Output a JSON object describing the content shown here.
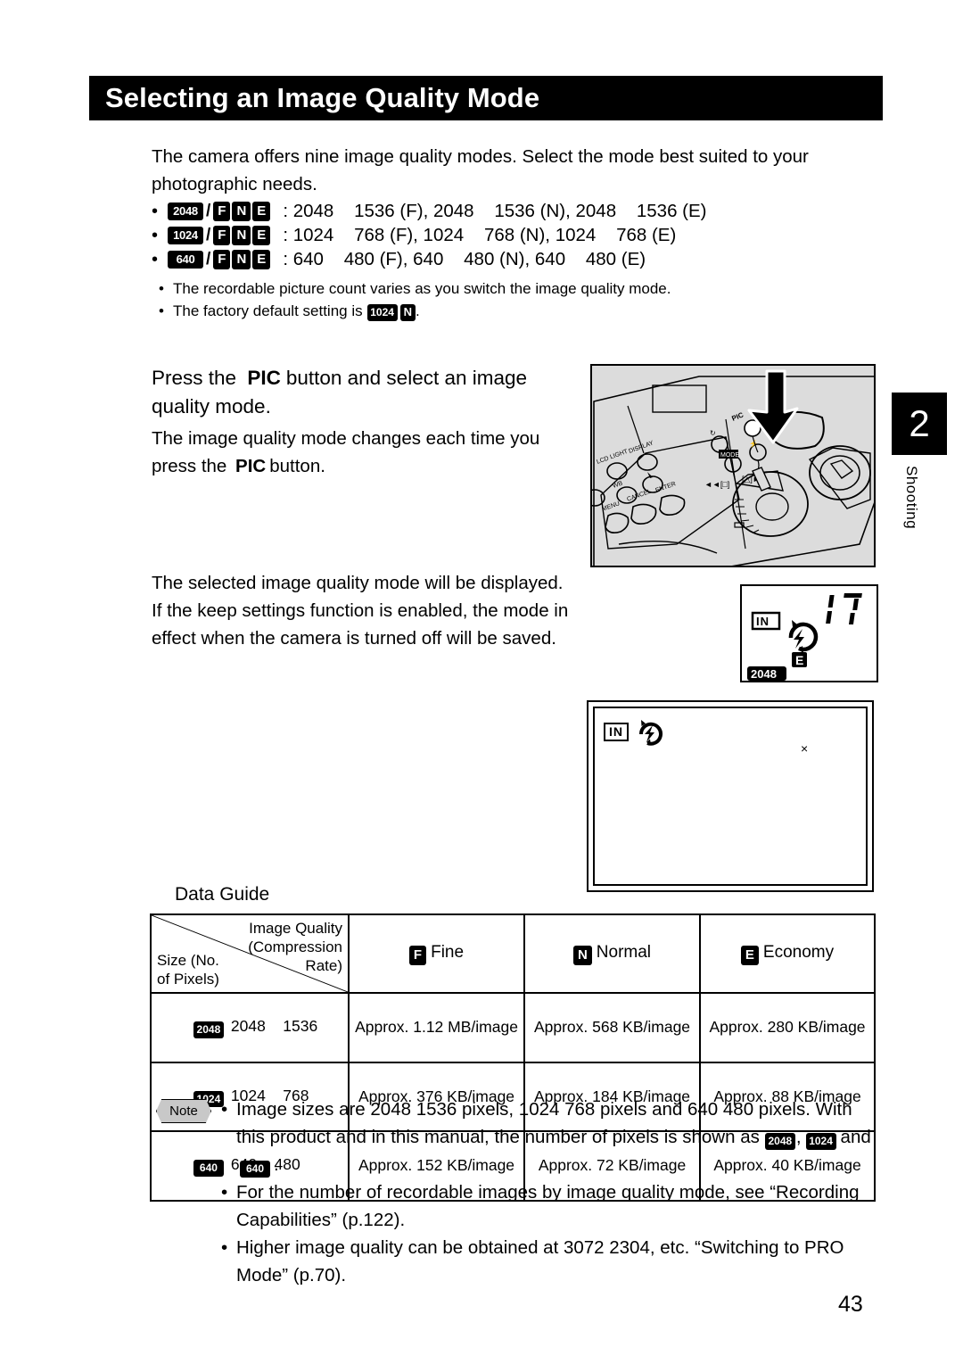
{
  "page": {
    "title": "Selecting an Image Quality Mode",
    "number": "43"
  },
  "chapter_tab": {
    "number": "2",
    "label": "Shooting"
  },
  "intro": {
    "paragraph": "The camera offers nine image quality modes. Select the mode best suited to your photographic needs.",
    "mode_lines": [
      {
        "size_badge": "2048",
        "quality_badges": [
          "F",
          "N",
          "E"
        ],
        "description": ": 2048    1536 (F), 2048    1536 (N), 2048    1536 (E)"
      },
      {
        "size_badge": "1024",
        "quality_badges": [
          "F",
          "N",
          "E"
        ],
        "description": ": 1024    768 (F), 1024    768 (N), 1024    768 (E)"
      },
      {
        "size_badge": "640",
        "quality_badges": [
          "F",
          "N",
          "E"
        ],
        "description": ": 640    480 (F), 640    480 (N), 640    480 (E)"
      }
    ],
    "sub_bullets": {
      "first": "The recordable picture count varies as you switch the image quality mode.",
      "second_prefix": "The factory default setting is",
      "second_badge_size": "1024",
      "second_badge_quality": "N",
      "second_suffix": "."
    }
  },
  "step1": {
    "heading_part1": "Press the",
    "heading_button": "PIC",
    "heading_part2": "button and select an image quality mode.",
    "sub_part1": "The image quality mode changes each time you press the",
    "sub_button": "PIC",
    "sub_part2": "button."
  },
  "step2": {
    "line1": "The selected image quality mode will be displayed.",
    "line2": "If the keep settings function is enabled, the mode in effect when the camera is turned off will be saved."
  },
  "figures": {
    "camera": {
      "callout_button": "PIC",
      "button_labels": [
        "LCD LIGHT",
        "DISPLAY",
        "WB",
        "MENU",
        "CANCEL",
        "ENTER"
      ]
    },
    "lcd_panel": {
      "in_label": "IN",
      "counter": "17",
      "quality_badge": "E",
      "size_badge": "2048"
    },
    "monitor": {
      "in_label": "IN",
      "center_mark": "×"
    }
  },
  "data_guide": {
    "title": "Data Guide",
    "header_corner": {
      "top_right_line1": "Image Quality",
      "top_right_line2": "(Compression",
      "top_right_line3": "Rate)",
      "bottom_left_line1": "Size (No.",
      "bottom_left_line2": "of Pixels)"
    },
    "columns": [
      {
        "badge": "F",
        "label": "Fine"
      },
      {
        "badge": "N",
        "label": "Normal"
      },
      {
        "badge": "E",
        "label": "Economy"
      }
    ],
    "rows": [
      {
        "badge": "2048",
        "size": "2048    1536",
        "values": [
          "Approx. 1.12 MB/image",
          "Approx. 568 KB/image",
          "Approx. 280 KB/image"
        ]
      },
      {
        "badge": "1024",
        "size": "1024    768",
        "values": [
          "Approx. 376 KB/image",
          "Approx. 184 KB/image",
          "Approx. 88 KB/image"
        ]
      },
      {
        "badge": "640",
        "size": "640    480",
        "values": [
          "Approx. 152 KB/image",
          "Approx. 72 KB/image",
          "Approx. 40 KB/image"
        ]
      }
    ]
  },
  "note": {
    "badge_label": "Note",
    "items": [
      {
        "text_before": "Image sizes are 2048    1536 pixels, 1024    768 pixels and 640    480 pixels. With this product and in this manual, the number of pixels is shown as",
        "badges": [
          "2048",
          "1024",
          "640"
        ],
        "separator": ",",
        "conjunction": "and",
        "text_after": "."
      },
      {
        "text": "For the number of recordable images by image quality mode, see “Recording Capabilities”     (p.122)."
      },
      {
        "text": "Higher image quality can be obtained at 3072    2304, etc. “Switching to PRO Mode”     (p.70)."
      }
    ]
  }
}
